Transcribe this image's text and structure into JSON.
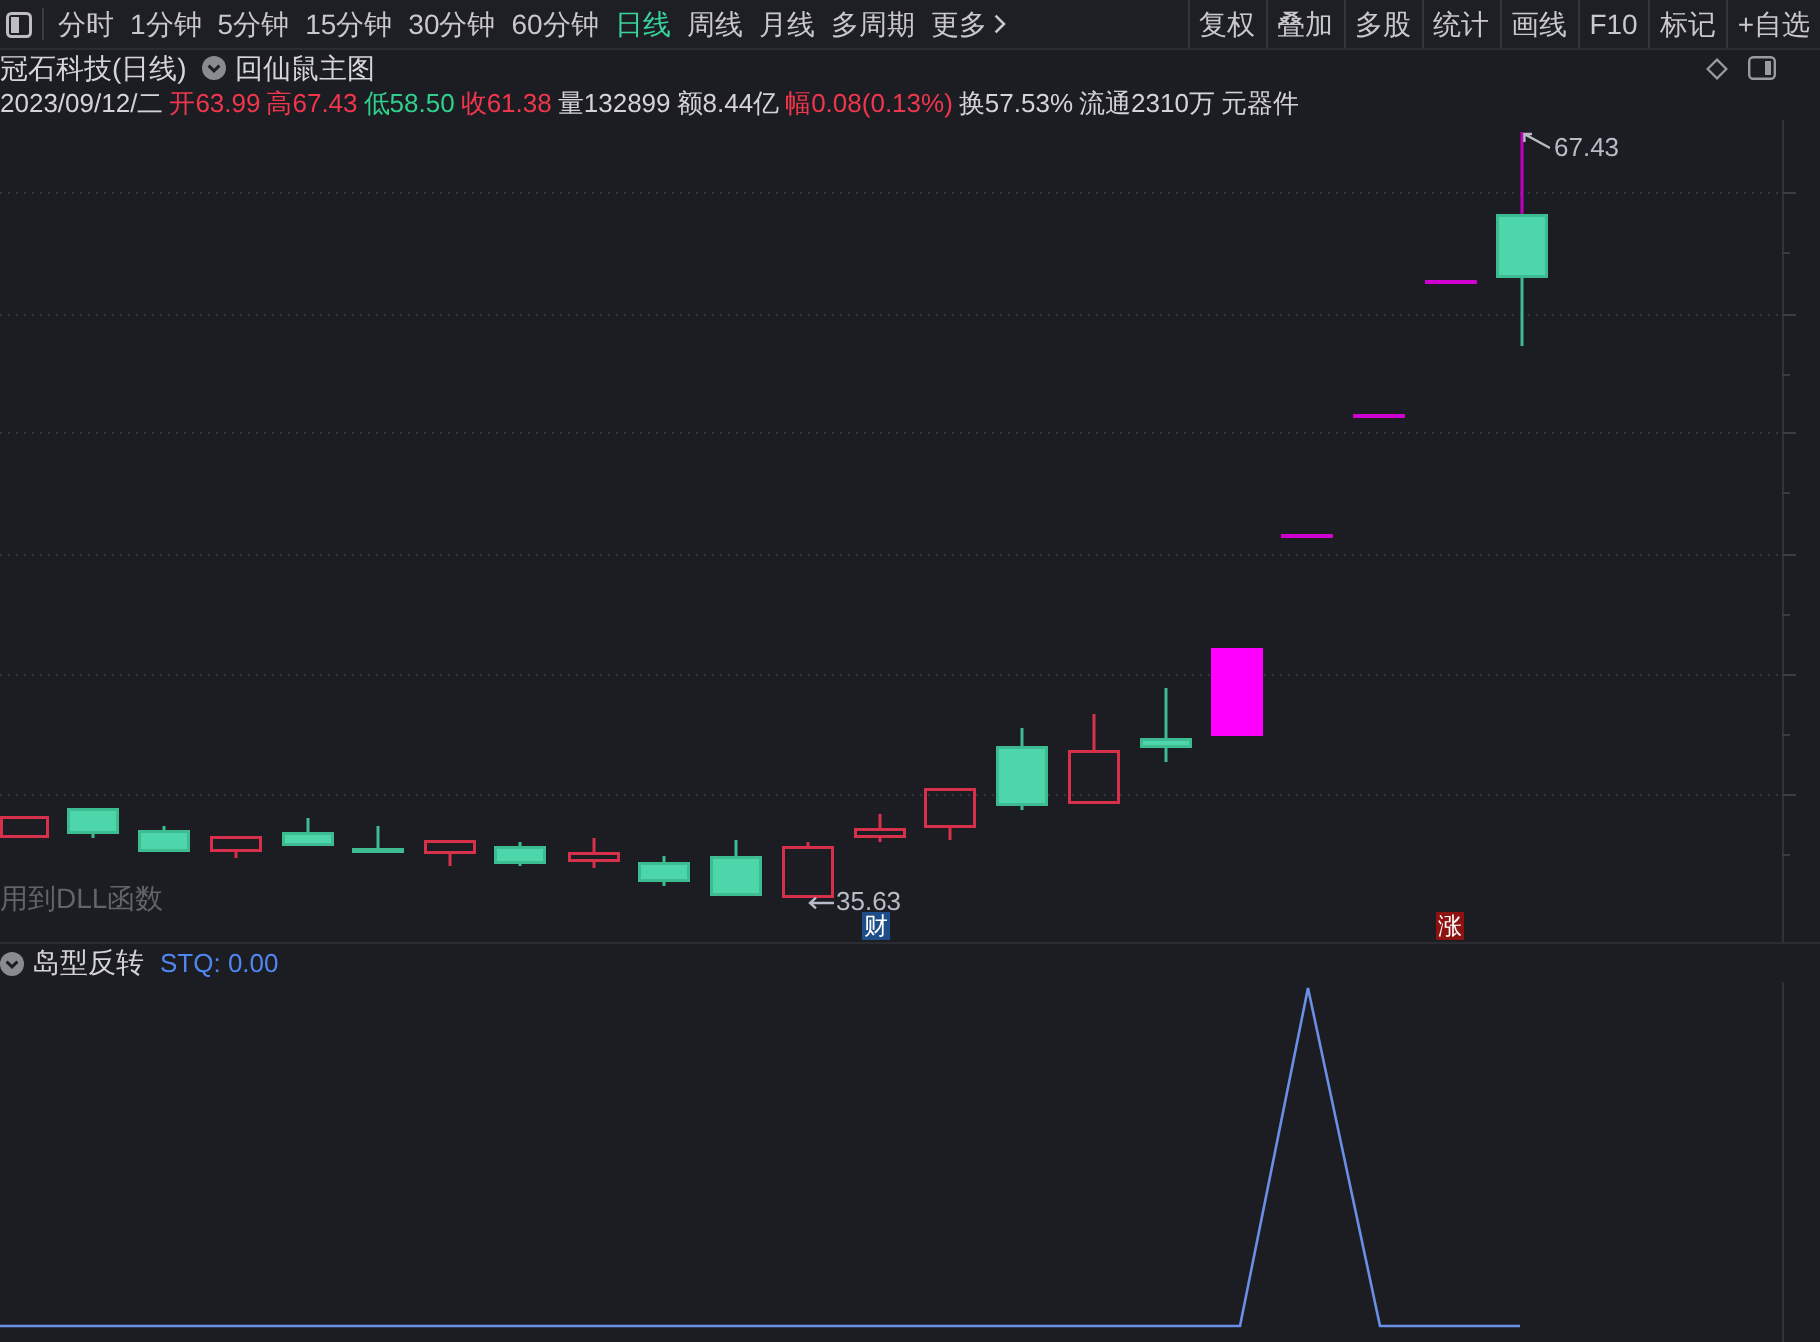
{
  "toolbar": {
    "periods": [
      {
        "label": "分时",
        "selected": false
      },
      {
        "label": "1分钟",
        "selected": false
      },
      {
        "label": "5分钟",
        "selected": false
      },
      {
        "label": "15分钟",
        "selected": false
      },
      {
        "label": "30分钟",
        "selected": false
      },
      {
        "label": "60分钟",
        "selected": false
      },
      {
        "label": "日线",
        "selected": true
      },
      {
        "label": "周线",
        "selected": false
      },
      {
        "label": "月线",
        "selected": false
      },
      {
        "label": "多周期",
        "selected": false
      }
    ],
    "more": "更多",
    "tools": [
      "复权",
      "叠加",
      "多股",
      "统计",
      "画线",
      "F10",
      "标记",
      "+自选"
    ]
  },
  "chart_header": {
    "title": "冠石科技(日线)",
    "template": "回仙鼠主图"
  },
  "quote": [
    {
      "text": "2023/09/12/二",
      "color": "#d4d4d8"
    },
    {
      "text": "开63.99",
      "color": "#f0364c"
    },
    {
      "text": "高67.43",
      "color": "#f0364c"
    },
    {
      "text": "低58.50",
      "color": "#2fd08c"
    },
    {
      "text": "收61.38",
      "color": "#f0364c"
    },
    {
      "text": "量132899",
      "color": "#d4d4d8"
    },
    {
      "text": "额8.44亿",
      "color": "#d4d4d8"
    },
    {
      "text": "幅0.08(0.13%)",
      "color": "#f0364c"
    },
    {
      "text": "换57.53%",
      "color": "#d4d4d8"
    },
    {
      "text": "流通2310万",
      "color": "#d4d4d8"
    },
    {
      "text": "元器件",
      "color": "#d4d4d8"
    }
  ],
  "main_chart": {
    "note": "用到DLL函数",
    "low_label": "35.63",
    "high_label": "67.43",
    "markers": [
      {
        "label": "财",
        "color": "#1d4e89"
      },
      {
        "label": "涨",
        "color": "#8c1212"
      }
    ]
  },
  "indicator": {
    "name": "岛型反转",
    "reading": "STQ: 0.00"
  }
}
